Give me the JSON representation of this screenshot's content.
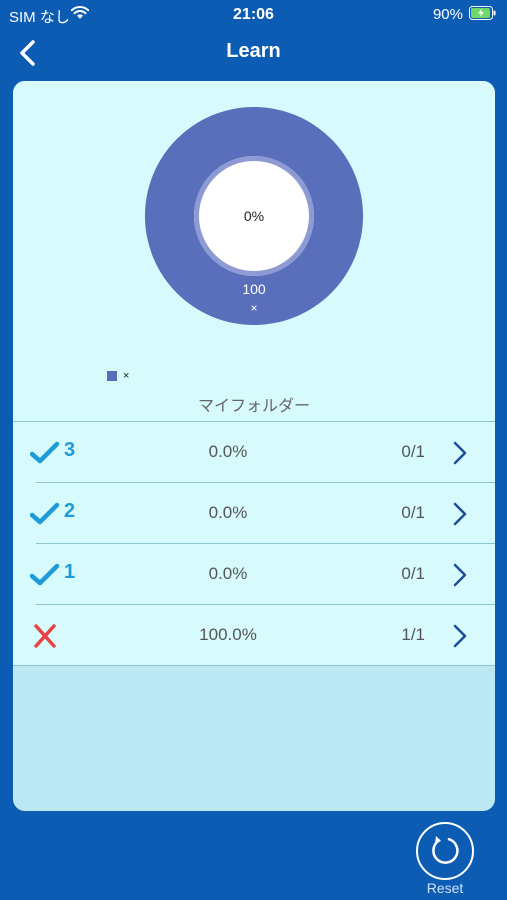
{
  "status_bar": {
    "carrier": "SIM なし",
    "time": "21:06",
    "battery": "90%"
  },
  "nav": {
    "title": "Learn",
    "back_icon": "chevron-left-icon"
  },
  "chart_data": {
    "type": "pie",
    "center_label": "0%",
    "slices": [
      {
        "label": "×",
        "value": 100,
        "color": "#5a6fbb"
      }
    ],
    "legend": [
      "×"
    ],
    "legend_placement": "bottom-left"
  },
  "folder": {
    "name": "マイフォルダー"
  },
  "rows": [
    {
      "icon": "check-icon",
      "level": "3",
      "percent": "0.0%",
      "fraction": "0/1"
    },
    {
      "icon": "check-icon",
      "level": "2",
      "percent": "0.0%",
      "fraction": "0/1"
    },
    {
      "icon": "check-icon",
      "level": "1",
      "percent": "0.0%",
      "fraction": "0/1"
    },
    {
      "icon": "cross-icon",
      "level": "",
      "percent": "100.0%",
      "fraction": "1/1"
    }
  ],
  "reset": {
    "label": "Reset",
    "icon": "reset-icon"
  },
  "colors": {
    "background": "#0d5cb3",
    "card_top": "#d7fafd",
    "card_bottom": "#bce8f3",
    "donut": "#5a6fbb",
    "check": "#1f9bd7",
    "cross": "#e84343"
  }
}
